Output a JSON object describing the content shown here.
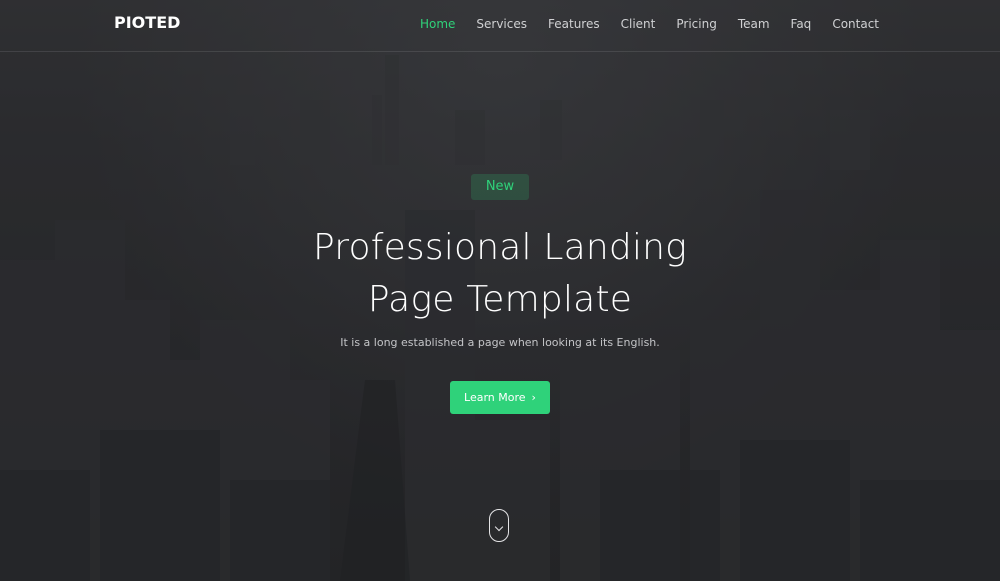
{
  "brand": {
    "logo_text": "PIOTED"
  },
  "nav": {
    "items": [
      {
        "label": "Home",
        "active": true
      },
      {
        "label": "Services"
      },
      {
        "label": "Features"
      },
      {
        "label": "Client"
      },
      {
        "label": "Pricing"
      },
      {
        "label": "Team"
      },
      {
        "label": "Faq"
      },
      {
        "label": "Contact"
      }
    ]
  },
  "hero": {
    "badge": "New",
    "title_line1": "Professional Landing",
    "title_line2": "Page Template",
    "subtitle": "It is a long established a page when looking at its English.",
    "cta_label": "Learn More",
    "cta_icon": "chevron-right-icon",
    "scroll_icon": "scroll-mouse-icon"
  },
  "colors": {
    "accent": "#2fd27a",
    "text_primary": "#ffffff",
    "text_muted": "#c4c5c8",
    "background": "#2f3033"
  }
}
